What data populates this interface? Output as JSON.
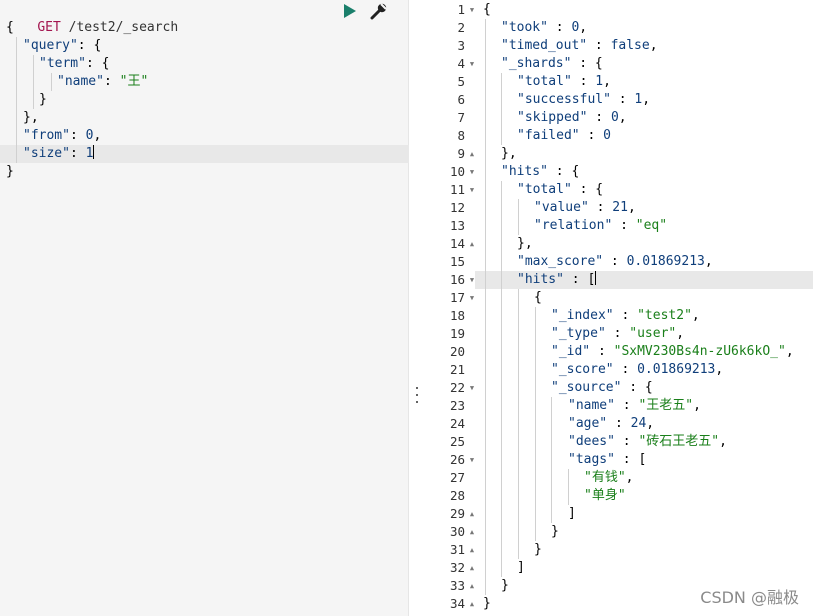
{
  "request": {
    "method": "GET",
    "path": "/test2/_search",
    "body": {
      "open": "{",
      "query_key": "\"query\"",
      "term_key": "\"term\"",
      "name_key": "\"name\"",
      "name_value": "\"王\"",
      "from_key": "\"from\"",
      "from_value": "0",
      "size_key": "\"size\"",
      "size_value": "1",
      "close": "}"
    },
    "run_icon": "play-icon",
    "settings_icon": "wrench-icon"
  },
  "response": {
    "line_numbers": [
      "1",
      "2",
      "3",
      "4",
      "5",
      "6",
      "7",
      "8",
      "9",
      "10",
      "11",
      "12",
      "13",
      "14",
      "15",
      "16",
      "17",
      "18",
      "19",
      "20",
      "21",
      "22",
      "23",
      "24",
      "25",
      "26",
      "27",
      "28",
      "29",
      "30",
      "31",
      "32",
      "33",
      "34"
    ],
    "took": "0",
    "timed_out": "false",
    "shards_total": "1",
    "shards_successful": "1",
    "shards_skipped": "0",
    "shards_failed": "0",
    "hits_total_value": "21",
    "hits_total_relation": "\"eq\"",
    "max_score": "0.01869213",
    "doc_index": "\"test2\"",
    "doc_type": "\"user\"",
    "doc_id": "\"SxMV230Bs4n-zU6k6kO_\"",
    "doc_score": "0.01869213",
    "source_name": "\"王老五\"",
    "source_age": "24",
    "source_dees": "\"砖石王老五\"",
    "tag_1": "\"有钱\"",
    "tag_2": "\"单身\""
  },
  "watermark": "CSDN @融极"
}
